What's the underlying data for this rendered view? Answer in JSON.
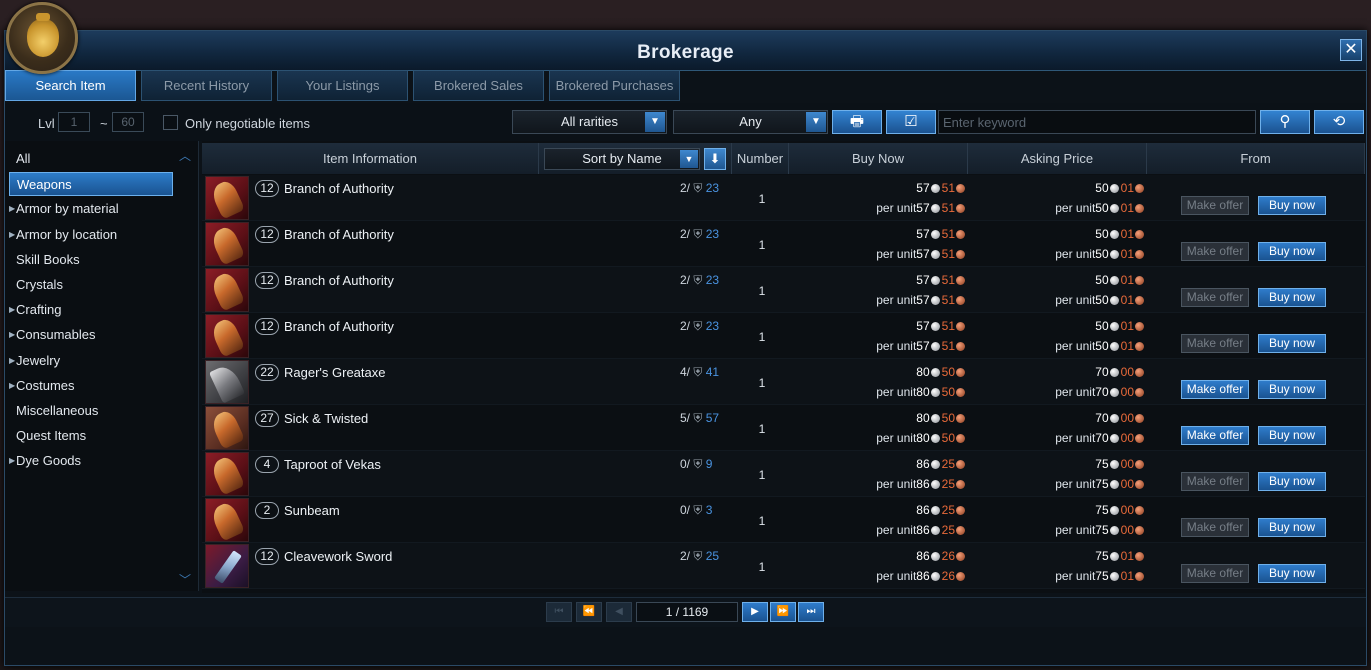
{
  "window": {
    "title": "Brokerage",
    "close_label": "✕"
  },
  "tabs": [
    {
      "label": "Search Item",
      "active": true
    },
    {
      "label": "Recent History",
      "active": false
    },
    {
      "label": "Your Listings",
      "active": false
    },
    {
      "label": "Brokered Sales",
      "active": false
    },
    {
      "label": "Brokered Purchases",
      "active": false
    }
  ],
  "filters": {
    "lvl_label": "Lvl",
    "lvl_min": "1",
    "lvl_separator": "~",
    "lvl_max": "60",
    "negotiable_label": "Only negotiable items",
    "negotiable_checked": false,
    "rarity_value": "All rarities",
    "grade_value": "Any",
    "keyword_placeholder": "Enter keyword"
  },
  "sidebar": {
    "items": [
      {
        "label": "All",
        "expandable": false
      },
      {
        "label": "Weapons",
        "expandable": false,
        "selected": true
      },
      {
        "label": "Armor by material",
        "expandable": true
      },
      {
        "label": "Armor by location",
        "expandable": true
      },
      {
        "label": "Skill Books",
        "expandable": false
      },
      {
        "label": "Crystals",
        "expandable": false
      },
      {
        "label": "Crafting",
        "expandable": true
      },
      {
        "label": "Consumables",
        "expandable": true
      },
      {
        "label": "Jewelry",
        "expandable": true
      },
      {
        "label": "Costumes",
        "expandable": true
      },
      {
        "label": "Miscellaneous",
        "expandable": false
      },
      {
        "label": "Quest Items",
        "expandable": false
      },
      {
        "label": "Dye Goods",
        "expandable": true
      }
    ]
  },
  "table": {
    "headers": {
      "item_info": "Item Information",
      "sort": "Sort by Name",
      "number": "Number",
      "buy_now": "Buy Now",
      "asking": "Asking Price",
      "from": "From"
    },
    "per_unit_label": "per unit",
    "make_offer_label": "Make offer",
    "buy_now_label": "Buy now",
    "rows": [
      {
        "level": "12",
        "name": "Branch of Authority",
        "icon": "staff-icon",
        "slots_used": "2/",
        "slots_max": "23",
        "number": "1",
        "buy_s": "57",
        "buy_c": "51",
        "buy_unit_s": "57",
        "buy_unit_c": "51",
        "ask_s": "50",
        "ask_c": "01",
        "ask_unit_s": "50",
        "ask_unit_c": "01",
        "offer_enabled": false
      },
      {
        "level": "12",
        "name": "Branch of Authority",
        "icon": "staff-icon",
        "slots_used": "2/",
        "slots_max": "23",
        "number": "1",
        "buy_s": "57",
        "buy_c": "51",
        "buy_unit_s": "57",
        "buy_unit_c": "51",
        "ask_s": "50",
        "ask_c": "01",
        "ask_unit_s": "50",
        "ask_unit_c": "01",
        "offer_enabled": false
      },
      {
        "level": "12",
        "name": "Branch of Authority",
        "icon": "staff-icon",
        "slots_used": "2/",
        "slots_max": "23",
        "number": "1",
        "buy_s": "57",
        "buy_c": "51",
        "buy_unit_s": "57",
        "buy_unit_c": "51",
        "ask_s": "50",
        "ask_c": "01",
        "ask_unit_s": "50",
        "ask_unit_c": "01",
        "offer_enabled": false
      },
      {
        "level": "12",
        "name": "Branch of Authority",
        "icon": "staff-icon",
        "slots_used": "2/",
        "slots_max": "23",
        "number": "1",
        "buy_s": "57",
        "buy_c": "51",
        "buy_unit_s": "57",
        "buy_unit_c": "51",
        "ask_s": "50",
        "ask_c": "01",
        "ask_unit_s": "50",
        "ask_unit_c": "01",
        "offer_enabled": false
      },
      {
        "level": "22",
        "name": "Rager's Greataxe",
        "icon": "axe-icon",
        "slots_used": "4/",
        "slots_max": "41",
        "number": "1",
        "buy_s": "80",
        "buy_c": "50",
        "buy_unit_s": "80",
        "buy_unit_c": "50",
        "ask_s": "70",
        "ask_c": "00",
        "ask_unit_s": "70",
        "ask_unit_c": "00",
        "offer_enabled": true
      },
      {
        "level": "27",
        "name": "Sick & Twisted",
        "icon": "sword-icon",
        "slots_used": "5/",
        "slots_max": "57",
        "number": "1",
        "buy_s": "80",
        "buy_c": "50",
        "buy_unit_s": "80",
        "buy_unit_c": "50",
        "ask_s": "70",
        "ask_c": "00",
        "ask_unit_s": "70",
        "ask_unit_c": "00",
        "offer_enabled": true
      },
      {
        "level": "4",
        "name": "Taproot of Vekas",
        "icon": "staff-icon",
        "slots_used": "0/",
        "slots_max": "9",
        "number": "1",
        "buy_s": "86",
        "buy_c": "25",
        "buy_unit_s": "86",
        "buy_unit_c": "25",
        "ask_s": "75",
        "ask_c": "00",
        "ask_unit_s": "75",
        "ask_unit_c": "00",
        "offer_enabled": false
      },
      {
        "level": "2",
        "name": "Sunbeam",
        "icon": "staff-icon",
        "slots_used": "0/",
        "slots_max": "3",
        "number": "1",
        "buy_s": "86",
        "buy_c": "25",
        "buy_unit_s": "86",
        "buy_unit_c": "25",
        "ask_s": "75",
        "ask_c": "00",
        "ask_unit_s": "75",
        "ask_unit_c": "00",
        "offer_enabled": false
      },
      {
        "level": "12",
        "name": "Cleavework Sword",
        "icon": "greatsword-icon",
        "slots_used": "2/",
        "slots_max": "25",
        "number": "1",
        "buy_s": "86",
        "buy_c": "26",
        "buy_unit_s": "86",
        "buy_unit_c": "26",
        "ask_s": "75",
        "ask_c": "01",
        "ask_unit_s": "75",
        "ask_unit_c": "01",
        "offer_enabled": false
      }
    ]
  },
  "pager": {
    "page_text": "1 / 1169"
  },
  "colors": {
    "accent": "#2a79c6",
    "copper": "#e86a3a",
    "link_blue": "#4a93e0"
  }
}
